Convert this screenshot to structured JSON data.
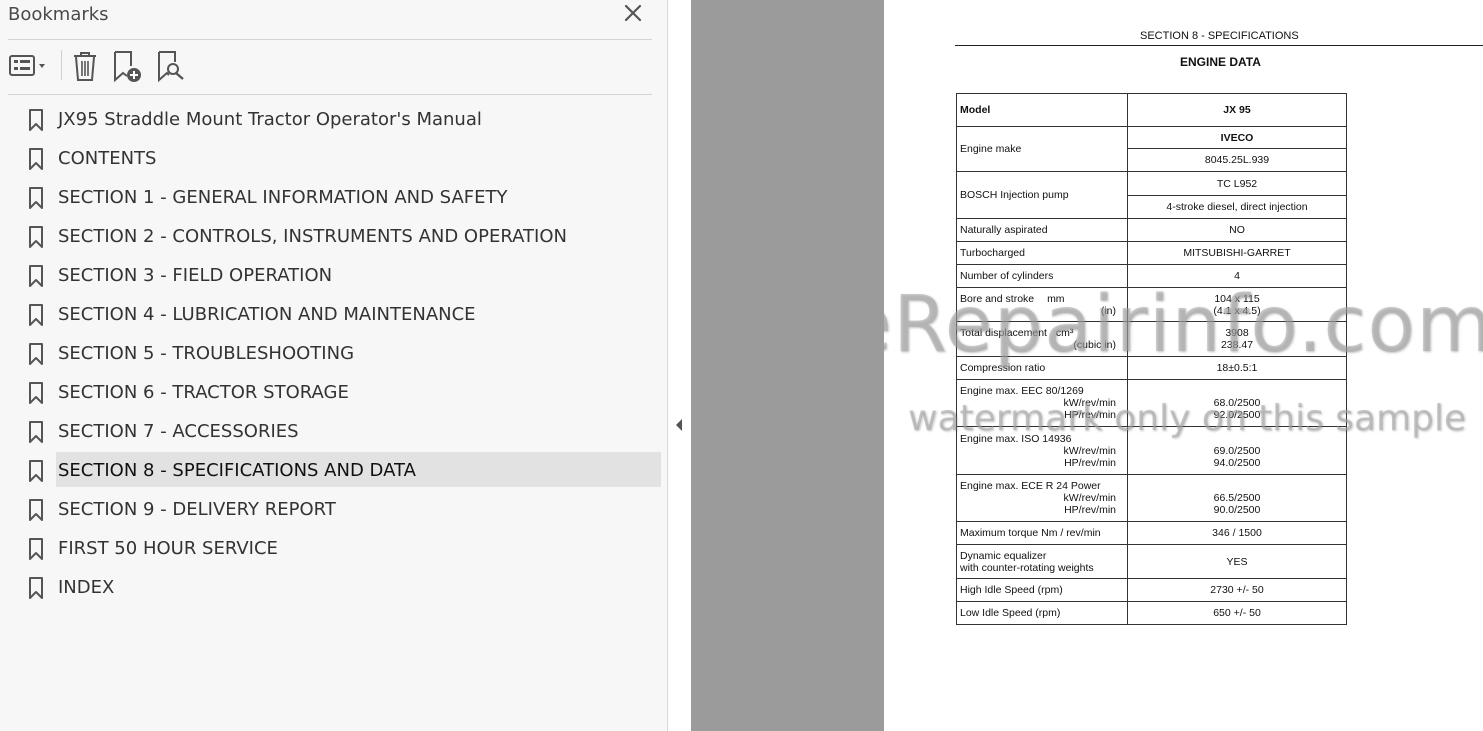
{
  "panel": {
    "title": "Bookmarks",
    "toolbar": {
      "options": "options-menu-icon",
      "delete": "trash-icon",
      "new_bookmark": "new-bookmark-icon",
      "find_bookmark": "find-bookmark-icon"
    },
    "bookmarks": [
      {
        "label": "JX95 Straddle Mount Tractor Operator's Manual"
      },
      {
        "label": "CONTENTS"
      },
      {
        "label": "SECTION 1 - GENERAL INFORMATION AND SAFETY"
      },
      {
        "label": "SECTION 2 - CONTROLS, INSTRUMENTS AND OPERATION"
      },
      {
        "label": "SECTION 3 - FIELD OPERATION"
      },
      {
        "label": "SECTION 4 - LUBRICATION AND MAINTENANCE"
      },
      {
        "label": "SECTION 5 - TROUBLESHOOTING"
      },
      {
        "label": "SECTION 6 - TRACTOR STORAGE"
      },
      {
        "label": "SECTION 7 - ACCESSORIES"
      },
      {
        "label": "SECTION 8 - SPECIFICATIONS AND DATA"
      },
      {
        "label": "SECTION 9 - DELIVERY REPORT"
      },
      {
        "label": "FIRST 50 HOUR SERVICE"
      },
      {
        "label": "INDEX"
      }
    ],
    "selected_index": 9
  },
  "document": {
    "section_header": "SECTION 8 - SPECIFICATIONS",
    "title": "ENGINE DATA",
    "rows": {
      "model": {
        "label": "Model",
        "value": "JX 95"
      },
      "engine_make": {
        "label": "Engine make",
        "value1": "IVECO",
        "value2": "8045.25L.939"
      },
      "injection": {
        "label": "BOSCH Injection pump",
        "value1": "TC L952",
        "value2": "4-stroke diesel, direct injection"
      },
      "aspirated": {
        "label": "Naturally aspirated",
        "value": "NO"
      },
      "turbo": {
        "label": "Turbocharged",
        "value": "MITSUBISHI-GARRET"
      },
      "cylinders": {
        "label": "Number of cylinders",
        "value": "4"
      },
      "bore": {
        "label": "Bore and stroke",
        "unit1": "mm",
        "unit2": "(in)",
        "value1": "104 x 115",
        "value2": "(4.1 x 4.5)"
      },
      "displacement": {
        "label": "Total displacement",
        "unit1": "cm³",
        "unit2": "(cubic in)",
        "value1": "3908",
        "value2": "238.47"
      },
      "compression": {
        "label": "Compression ratio",
        "value": "18±0.5:1"
      },
      "eec": {
        "label": "Engine max.  EEC 80/1269",
        "unit1": "kW/rev/min",
        "unit2": "HP/rev/min",
        "value1": "68.0/2500",
        "value2": "92.0/2500"
      },
      "iso": {
        "label": "Engine max.  ISO 14936",
        "unit1": "kW/rev/min",
        "unit2": "HP/rev/min",
        "value1": "69.0/2500",
        "value2": "94.0/2500"
      },
      "ece": {
        "label": "Engine max.  ECE  R 24 Power",
        "unit1": "kW/rev/min",
        "unit2": "HP/rev/min",
        "value1": "66.5/2500",
        "value2": "90.0/2500"
      },
      "torque": {
        "label": "Maximum torque  Nm / rev/min",
        "value": "346 / 1500"
      },
      "equalizer": {
        "label1": "Dynamic equalizer",
        "label2": "with counter-rotating weights",
        "value": "YES"
      },
      "high_idle": {
        "label": "High Idle Speed (rpm)",
        "value": "2730 +/- 50"
      },
      "low_idle": {
        "label": "Low Idle Speed (rpm)",
        "value": "650 +/- 50"
      }
    },
    "watermark_main": "eRepairinfo.com",
    "watermark_sub": "watermark only on this sample"
  }
}
